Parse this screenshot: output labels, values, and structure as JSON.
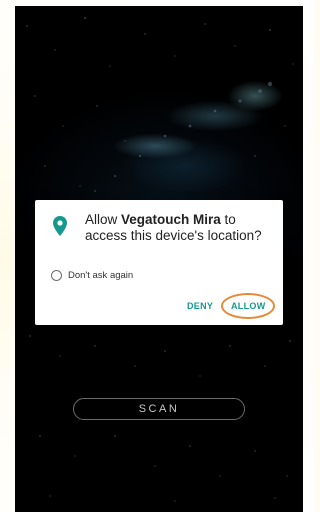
{
  "dialog": {
    "prompt_before": "Allow ",
    "app_name": "Vegatouch Mira",
    "prompt_after": " to access this device's location?",
    "dont_ask_label": "Don't ask again",
    "deny_label": "DENY",
    "allow_label": "ALLOW",
    "icon": "location-pin-icon"
  },
  "scan_button": {
    "label": "SCAN"
  },
  "colors": {
    "accent": "#15998c",
    "highlight": "#e58a3b",
    "dialog_bg": "#ffffff",
    "background": "#000000"
  }
}
